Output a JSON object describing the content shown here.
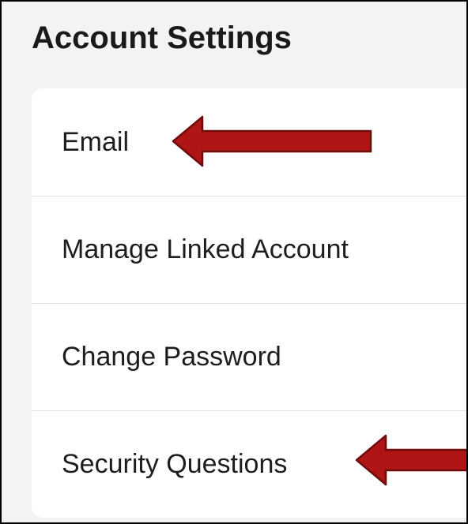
{
  "page": {
    "title": "Account Settings"
  },
  "settings": {
    "items": [
      {
        "label": "Email"
      },
      {
        "label": "Manage Linked Account"
      },
      {
        "label": "Change Password"
      },
      {
        "label": "Security Questions"
      }
    ]
  },
  "annotations": {
    "arrow_color": "#b01515",
    "arrow_outline": "#6e0b0b"
  }
}
